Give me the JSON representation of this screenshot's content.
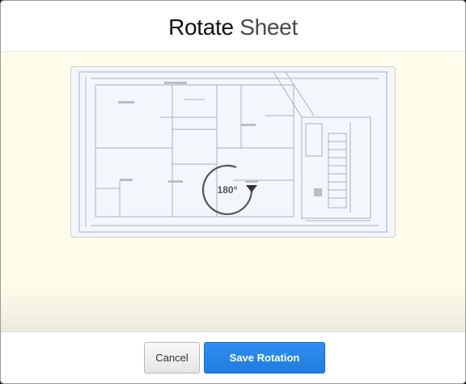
{
  "dialog": {
    "title_primary": "Rotate",
    "title_secondary": "Sheet"
  },
  "preview": {
    "rotation_label": "180°",
    "rotation_degrees": 180
  },
  "footer": {
    "cancel_label": "Cancel",
    "save_label": "Save Rotation"
  },
  "colors": {
    "body_background": "#fefcea",
    "primary_button": "#2583e8",
    "rotate_icon": "#555555"
  },
  "icons": {
    "rotate": "rotate-clockwise-icon",
    "sheet": "floor-plan-thumbnail"
  }
}
